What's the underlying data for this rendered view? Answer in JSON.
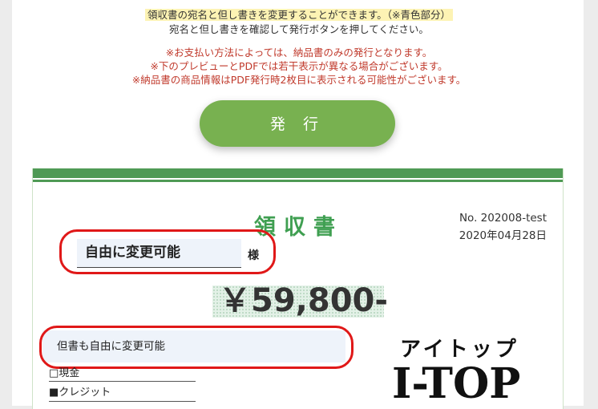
{
  "intro": {
    "line1": "領収書の宛名と但し書きを変更することができます。（※青色部分）",
    "line2": "宛名と但し書きを確認して発行ボタンを押してください。"
  },
  "notes": [
    "※お支払い方法によっては、納品書のみの発行となります。",
    "※下のプレビューとPDFでは若干表示が異なる場合がございます。",
    "※納品書の商品情報はPDF発行時2枚目に表示される可能性がございます。"
  ],
  "issue_button": "発 行",
  "receipt": {
    "title": "領収書",
    "number": "No. 202008-test",
    "date": "2020年04月28日",
    "addressee": "自由に変更可能",
    "honorific": "様",
    "amount": "￥59,800-",
    "purpose": "但書も自由に変更可能",
    "payment_cash": "□現金",
    "payment_credit": "■クレジット"
  },
  "logo": {
    "kana": "アイトップ",
    "text": "I-TOP"
  },
  "colors": {
    "brand_green": "#3f9f51",
    "button_green": "#78b150",
    "warning_red": "#c0392b",
    "highlight_red": "#e01818",
    "editable_blue": "#eef3fa"
  }
}
